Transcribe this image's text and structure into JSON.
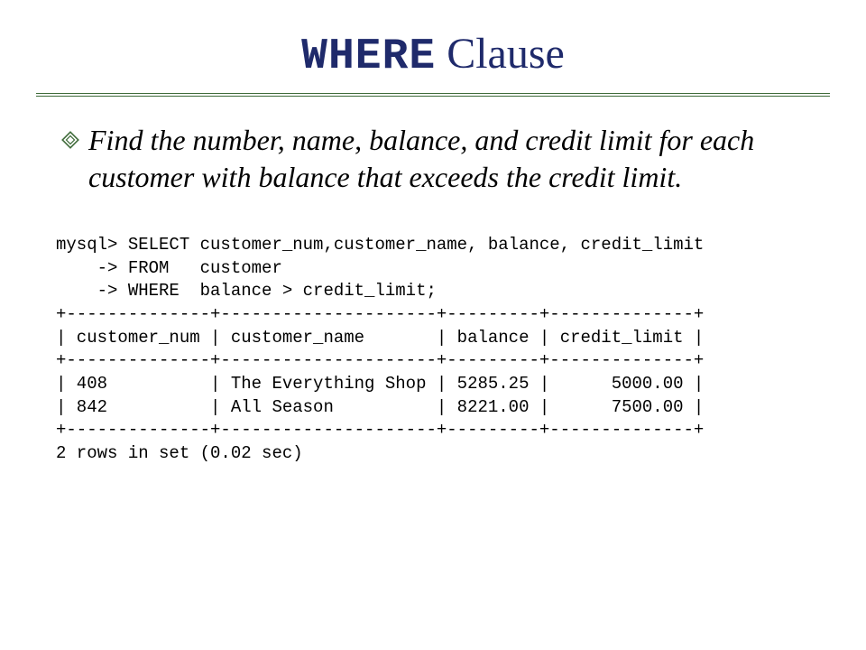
{
  "title": {
    "keyword": "WHERE",
    "rest": " Clause"
  },
  "bullet_icon": "diamond-hollow-icon",
  "prompt_text": "Find the number, name, balance, and credit limit for each customer with balance that exceeds the credit limit.",
  "sql_output": "mysql> SELECT customer_num,customer_name, balance, credit_limit\n    -> FROM   customer\n    -> WHERE  balance > credit_limit;\n+--------------+---------------------+---------+--------------+\n| customer_num | customer_name       | balance | credit_limit |\n+--------------+---------------------+---------+--------------+\n| 408          | The Everything Shop | 5285.25 |      5000.00 |\n| 842          | All Season          | 8221.00 |      7500.00 |\n+--------------+---------------------+---------+--------------+\n2 rows in set (0.02 sec)"
}
